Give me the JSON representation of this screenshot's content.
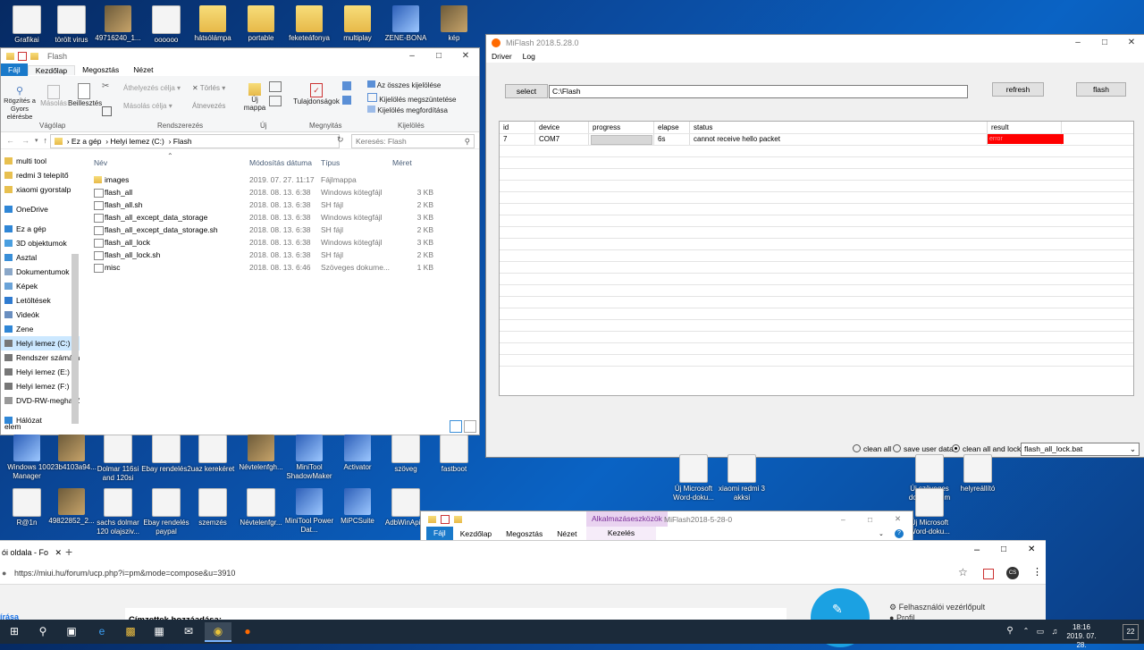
{
  "desktop": {
    "top_icons": [
      "Grafikai",
      "törölt virus",
      "49716240_1...",
      "oooooo",
      "hátsólámpa",
      "portable",
      "feketeáfonya",
      "multiplay",
      "ZENE-BONA",
      "kép"
    ],
    "row2_icons": [
      "Windows 10 Manager",
      "023b4103a94...",
      "Dolmar 116si and 120si",
      "Ebay rendelés2",
      "uaz kerekéret",
      "Névtelenfgh...",
      "MiniTool ShadowMaker",
      "Activator",
      "szöveg",
      "fastboot"
    ],
    "row3_icons": [
      "R@1n",
      "49822852_2...",
      "sachs dolmar 120 olajsziv...",
      "Ebay rendelés paypal",
      "szemzés",
      "Névtelenfgr...",
      "MiniTool Power Dat...",
      "MiPCSuite",
      "AdbWinApi..."
    ],
    "right_icons": [
      "Új Microsoft Word-doku...",
      "xiaomi redmi 3 akksi",
      "Új szöveges dokumentum",
      "helyreállító",
      "Új Microsoft Word-doku..."
    ]
  },
  "explorer": {
    "title": "Flash",
    "tabs": [
      "Fájl",
      "Kezdőlap",
      "Megosztás",
      "Nézet"
    ],
    "ribbon": {
      "pin_label": "Rögzítés a Gyors elérésbe",
      "copy": "Másolás",
      "paste": "Beillesztés",
      "group_clipboard": "Vágólap",
      "move_to": "Áthelyezés célja",
      "copy_to": "Másolás célja",
      "delete": "Törlés",
      "rename": "Átnevezés",
      "group_organize": "Rendszerezés",
      "new_folder": "Új mappa",
      "group_new": "Új",
      "properties": "Tulajdonságok",
      "group_open": "Megnyitás",
      "select_all": "Az összes kijelölése",
      "select_none": "Kijelölés megszüntetése",
      "invert": "Kijelölés megfordítása",
      "group_select": "Kijelölés"
    },
    "breadcrumb": [
      "Ez a gép",
      "Helyi lemez (C:)",
      "Flash"
    ],
    "search_placeholder": "Keresés: Flash",
    "nav": [
      "multi tool",
      "redmi 3 telepítő",
      "xiaomi gyorstalp",
      "OneDrive",
      "Ez a gép",
      "3D objektumok",
      "Asztal",
      "Dokumentumok",
      "Képek",
      "Letöltések",
      "Videók",
      "Zene",
      "Helyi lemez (C:)",
      "Rendszer számára",
      "Helyi lemez (E:)",
      "Helyi lemez (F:)",
      "DVD-RW-meghajtó",
      "Hálózat"
    ],
    "columns": [
      "Név",
      "Módosítás dátuma",
      "Típus",
      "Méret"
    ],
    "files": [
      {
        "name": "images",
        "date": "2019. 07. 27. 11:17",
        "type": "Fájlmappa",
        "size": ""
      },
      {
        "name": "flash_all",
        "date": "2018. 08. 13. 6:38",
        "type": "Windows kötegfájl",
        "size": "3 KB"
      },
      {
        "name": "flash_all.sh",
        "date": "2018. 08. 13. 6:38",
        "type": "SH fájl",
        "size": "2 KB"
      },
      {
        "name": "flash_all_except_data_storage",
        "date": "2018. 08. 13. 6:38",
        "type": "Windows kötegfájl",
        "size": "3 KB"
      },
      {
        "name": "flash_all_except_data_storage.sh",
        "date": "2018. 08. 13. 6:38",
        "type": "SH fájl",
        "size": "2 KB"
      },
      {
        "name": "flash_all_lock",
        "date": "2018. 08. 13. 6:38",
        "type": "Windows kötegfájl",
        "size": "3 KB"
      },
      {
        "name": "flash_all_lock.sh",
        "date": "2018. 08. 13. 6:38",
        "type": "SH fájl",
        "size": "2 KB"
      },
      {
        "name": "misc",
        "date": "2018. 08. 13. 6:46",
        "type": "Szöveges dokume...",
        "size": "1 KB"
      }
    ],
    "status": "elem"
  },
  "miflash": {
    "title": "MiFlash 2018.5.28.0",
    "menu": [
      "Driver",
      "Log"
    ],
    "select_label": "select",
    "path_value": "C:\\Flash",
    "refresh_label": "refresh",
    "flash_label": "flash",
    "columns": [
      "id",
      "device",
      "progress",
      "elapse",
      "status",
      "result"
    ],
    "rows": [
      {
        "id": "7",
        "device": "COM7",
        "progress": "",
        "elapse": "6s",
        "status": "cannot receive hello packet",
        "result": "error"
      }
    ],
    "progress_fraction": 1.0,
    "result_color": "#ff0000",
    "options": [
      "clean all",
      "save user data",
      "clean all and lock"
    ],
    "selected_option": "clean all and lock",
    "script": "flash_all_lock.bat"
  },
  "explorer2": {
    "title": "MiFlash2018-5-28-0",
    "context_tab": "Alkalmazáseszközök",
    "tabs": [
      "Fájl",
      "Kezdőlap",
      "Megosztás",
      "Nézet"
    ],
    "sub_tab": "Kezelés"
  },
  "browser": {
    "tab_title": "ói oldala - Fo",
    "url": "https://miui.hu/forum/ucp.php?i=pm&mode=compose&u=3910",
    "left_link": "írása",
    "heading": "Címzettek hozzáadása:",
    "right_links": [
      "Felhasználói vezérlőpult",
      "Profil"
    ],
    "avatar_initials": "CS"
  },
  "taskbar": {
    "time": "18:16",
    "date": "2019. 07. 28.",
    "notification_count": "22"
  }
}
